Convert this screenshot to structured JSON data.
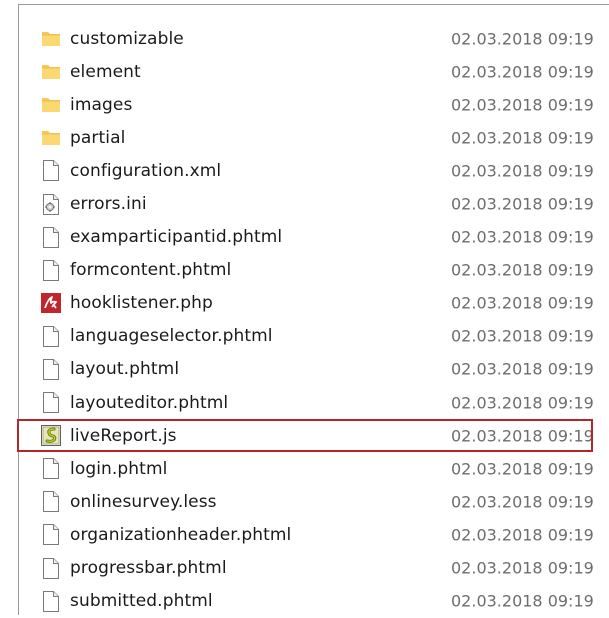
{
  "files": [
    {
      "name": "customizable",
      "date": "02.03.2018 09:19",
      "icon": "folder-icon"
    },
    {
      "name": "element",
      "date": "02.03.2018 09:19",
      "icon": "folder-icon"
    },
    {
      "name": "images",
      "date": "02.03.2018 09:19",
      "icon": "folder-icon"
    },
    {
      "name": "partial",
      "date": "02.03.2018 09:19",
      "icon": "folder-icon"
    },
    {
      "name": "configuration.xml",
      "date": "02.03.2018 09:19",
      "icon": "file-icon"
    },
    {
      "name": "errors.ini",
      "date": "02.03.2018 09:19",
      "icon": "settings-file-icon"
    },
    {
      "name": "examparticipantid.phtml",
      "date": "02.03.2018 09:19",
      "icon": "file-icon"
    },
    {
      "name": "formcontent.phtml",
      "date": "02.03.2018 09:19",
      "icon": "file-icon"
    },
    {
      "name": "hooklistener.php",
      "date": "02.03.2018 09:19",
      "icon": "php-file-icon"
    },
    {
      "name": "languageselector.phtml",
      "date": "02.03.2018 09:19",
      "icon": "file-icon"
    },
    {
      "name": "layout.phtml",
      "date": "02.03.2018 09:19",
      "icon": "file-icon"
    },
    {
      "name": "layouteditor.phtml",
      "date": "02.03.2018 09:19",
      "icon": "file-icon"
    },
    {
      "name": "liveReport.js",
      "date": "02.03.2018 09:19",
      "icon": "script-file-icon"
    },
    {
      "name": "login.phtml",
      "date": "02.03.2018 09:19",
      "icon": "file-icon"
    },
    {
      "name": "onlinesurvey.less",
      "date": "02.03.2018 09:19",
      "icon": "file-icon"
    },
    {
      "name": "organizationheader.phtml",
      "date": "02.03.2018 09:19",
      "icon": "file-icon"
    },
    {
      "name": "progressbar.phtml",
      "date": "02.03.2018 09:19",
      "icon": "file-icon"
    },
    {
      "name": "submitted.phtml",
      "date": "02.03.2018 09:19",
      "icon": "file-icon"
    }
  ],
  "highlighted_file": "liveReport.js",
  "colors": {
    "highlight_border": "#b3262a",
    "folder": "#f7d16b",
    "date_text": "#6d6d6d"
  }
}
